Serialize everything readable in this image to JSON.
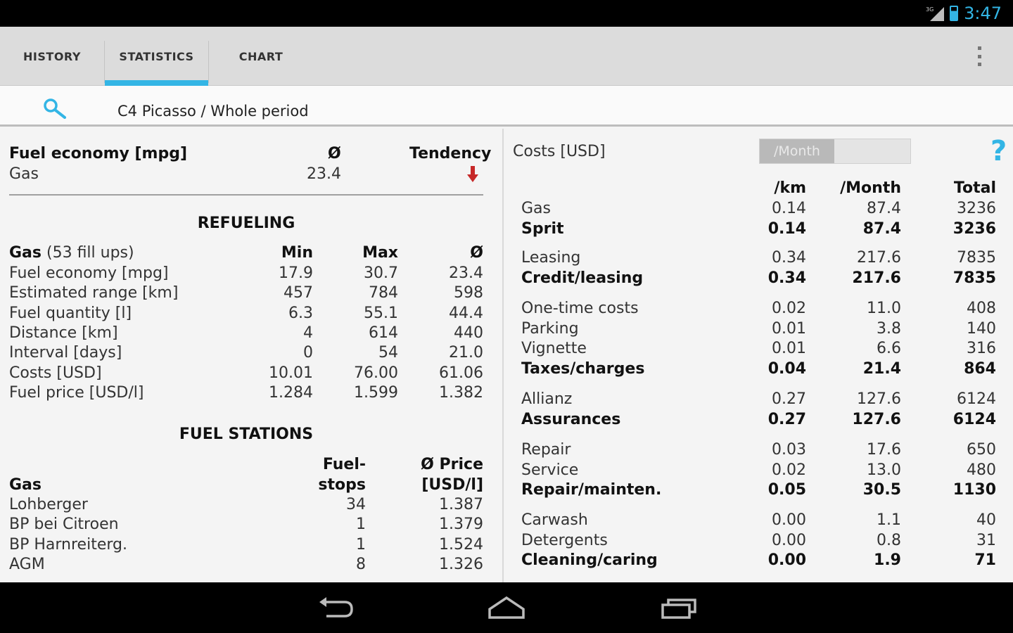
{
  "status": {
    "time": "3:47",
    "network": "3G"
  },
  "tabs": [
    {
      "label": "HISTORY"
    },
    {
      "label": "STATISTICS"
    },
    {
      "label": "CHART"
    }
  ],
  "filter": {
    "text": "C4 Picasso / Whole period"
  },
  "economy": {
    "title": "Fuel economy [mpg]",
    "avg_header": "Ø",
    "tendency_header": "Tendency",
    "fuel_label": "Gas",
    "avg_value": "23.4"
  },
  "refueling": {
    "title": "REFUELING",
    "fuel_name": "Gas",
    "fill_ups": "(53 fill ups)",
    "headers": {
      "min": "Min",
      "max": "Max",
      "avg": "Ø"
    },
    "rows": [
      {
        "label": "Fuel economy [mpg]",
        "min": "17.9",
        "max": "30.7",
        "avg": "23.4"
      },
      {
        "label": "Estimated range [km]",
        "min": "457",
        "max": "784",
        "avg": "598"
      },
      {
        "label": "Fuel quantity [l]",
        "min": "6.3",
        "max": "55.1",
        "avg": "44.4"
      },
      {
        "label": "Distance [km]",
        "min": "4",
        "max": "614",
        "avg": "440"
      },
      {
        "label": "Interval [days]",
        "min": "0",
        "max": "54",
        "avg": "21.0"
      },
      {
        "label": "Costs [USD]",
        "min": "10.01",
        "max": "76.00",
        "avg": "61.06"
      },
      {
        "label": "Fuel price [USD/l]",
        "min": "1.284",
        "max": "1.599",
        "avg": "1.382"
      }
    ]
  },
  "stations": {
    "title": "FUEL STATIONS",
    "fuel_name": "Gas",
    "header_stops_1": "Fuel-",
    "header_stops_2": "stops",
    "header_price_1": "Ø Price",
    "header_price_2": "[USD/l]",
    "rows": [
      {
        "name": "Lohberger",
        "stops": "34",
        "price": "1.387"
      },
      {
        "name": "BP bei Citroen",
        "stops": "1",
        "price": "1.379"
      },
      {
        "name": "BP Harnreiterg.",
        "stops": "1",
        "price": "1.524"
      },
      {
        "name": "AGM",
        "stops": "8",
        "price": "1.326"
      }
    ]
  },
  "costs": {
    "title": "Costs [USD]",
    "toggle_on": "/Month",
    "toggle_off": "",
    "help": "?",
    "headers": {
      "km": "/km",
      "month": "/Month",
      "total": "Total"
    },
    "groups": [
      {
        "items": [
          {
            "label": "Gas",
            "km": "0.14",
            "month": "87.4",
            "total": "3236"
          }
        ],
        "sum": {
          "label": "Sprit",
          "km": "0.14",
          "month": "87.4",
          "total": "3236"
        }
      },
      {
        "items": [
          {
            "label": "Leasing",
            "km": "0.34",
            "month": "217.6",
            "total": "7835"
          }
        ],
        "sum": {
          "label": "Credit/leasing",
          "km": "0.34",
          "month": "217.6",
          "total": "7835"
        }
      },
      {
        "items": [
          {
            "label": "One-time costs",
            "km": "0.02",
            "month": "11.0",
            "total": "408"
          },
          {
            "label": "Parking",
            "km": "0.01",
            "month": "3.8",
            "total": "140"
          },
          {
            "label": "Vignette",
            "km": "0.01",
            "month": "6.6",
            "total": "316"
          }
        ],
        "sum": {
          "label": "Taxes/charges",
          "km": "0.04",
          "month": "21.4",
          "total": "864"
        }
      },
      {
        "items": [
          {
            "label": "Allianz",
            "km": "0.27",
            "month": "127.6",
            "total": "6124"
          }
        ],
        "sum": {
          "label": "Assurances",
          "km": "0.27",
          "month": "127.6",
          "total": "6124"
        }
      },
      {
        "items": [
          {
            "label": "Repair",
            "km": "0.03",
            "month": "17.6",
            "total": "650"
          },
          {
            "label": "Service",
            "km": "0.02",
            "month": "13.0",
            "total": "480"
          }
        ],
        "sum": {
          "label": "Repair/mainten.",
          "km": "0.05",
          "month": "30.5",
          "total": "1130"
        }
      },
      {
        "items": [
          {
            "label": "Carwash",
            "km": "0.00",
            "month": "1.1",
            "total": "40"
          },
          {
            "label": "Detergents",
            "km": "0.00",
            "month": "0.8",
            "total": "31"
          }
        ],
        "sum": {
          "label": "Cleaning/caring",
          "km": "0.00",
          "month": "1.9",
          "total": "71"
        }
      }
    ]
  },
  "colors": {
    "accent": "#33b5e5",
    "tendency_down": "#c62828"
  }
}
